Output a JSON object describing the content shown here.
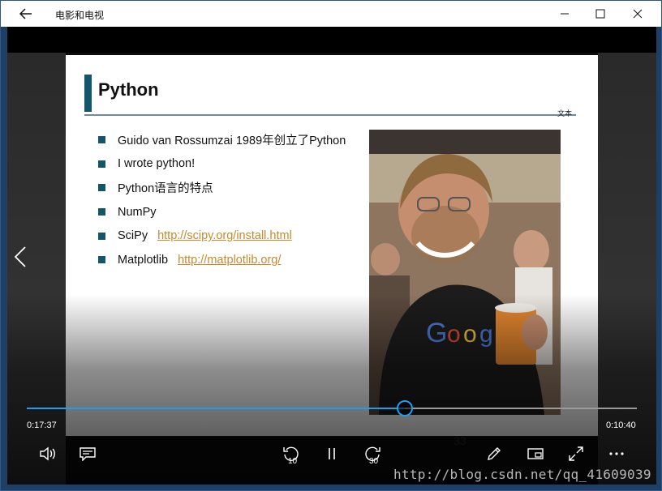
{
  "window": {
    "app_title": "电影和电视"
  },
  "slide": {
    "title": "Python",
    "tag": "文本",
    "bullets": [
      {
        "text": "Guido van Rossumzai 1989年创立了Python",
        "link": ""
      },
      {
        "text": "I  wrote python!",
        "link": ""
      },
      {
        "text": "Python语言的特点",
        "link": ""
      },
      {
        "text": "NumPy",
        "link": ""
      },
      {
        "text": "SciPy",
        "link": "http://scipy.org/install.html"
      },
      {
        "text": "Matplotlib",
        "link": "http://matplotlib.org/"
      }
    ],
    "page_number": "33"
  },
  "player": {
    "elapsed": "0:17:37",
    "remaining": "0:10:40",
    "progress_fraction": 0.62,
    "skip_back_seconds": "10",
    "skip_forward_seconds": "30"
  },
  "watermark": "http://blog.csdn.net/qq_41609039",
  "icons": {
    "back": "back-arrow-icon",
    "minimize": "minimize-icon",
    "maximize": "maximize-icon",
    "close": "close-icon",
    "volume": "volume-icon",
    "subtitles": "subtitles-icon",
    "skip_back": "skip-back-icon",
    "pause": "pause-icon",
    "skip_forward": "skip-forward-icon",
    "pen": "pen-icon",
    "miniview": "mini-view-icon",
    "fullscreen": "fullscreen-icon",
    "more": "more-icon",
    "prev": "chevron-left-icon"
  },
  "colors": {
    "accent": "#1f9df0",
    "slide_accent": "#13556b",
    "link": "#c78a2a"
  }
}
